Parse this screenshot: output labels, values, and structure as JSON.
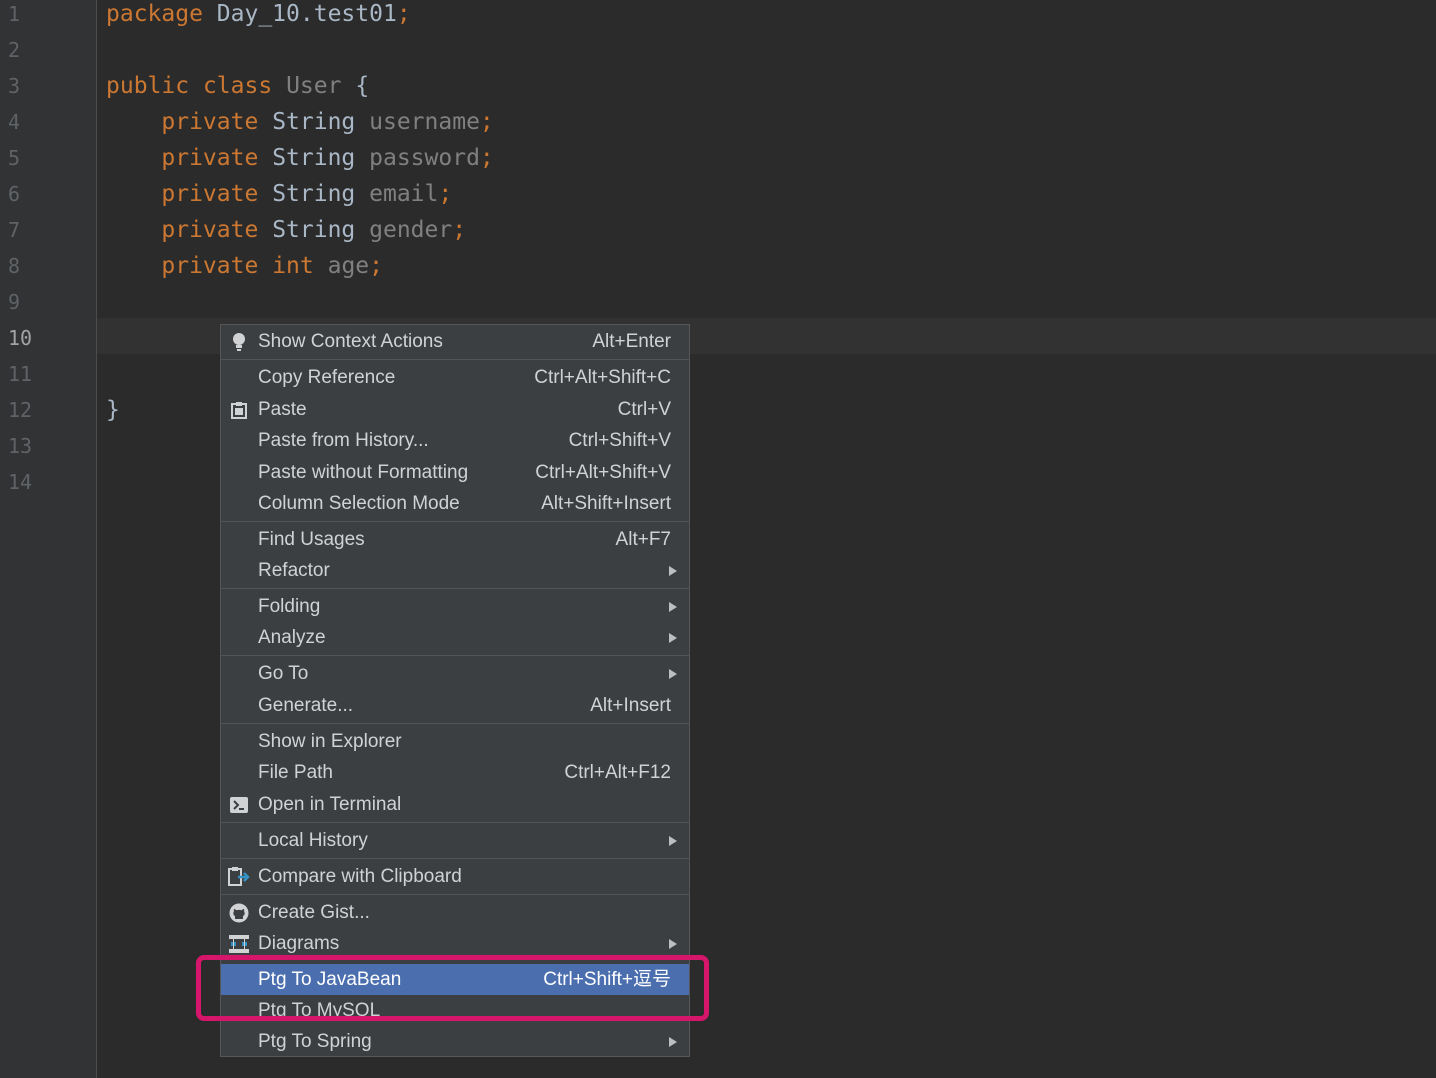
{
  "gutter": {
    "line_numbers": [
      "1",
      "2",
      "3",
      "4",
      "5",
      "6",
      "7",
      "8",
      "9",
      "10",
      "11",
      "12",
      "13",
      "14"
    ]
  },
  "code": {
    "line1": {
      "kw": "package",
      "pkg": "Day_10.test01",
      "semi": ";"
    },
    "line3": {
      "kw1": "public",
      "kw2": "class",
      "name": "User",
      "brace": "{"
    },
    "fields": [
      {
        "mod": "private",
        "type": "String",
        "name": "username",
        "semi": ";"
      },
      {
        "mod": "private",
        "type": "String",
        "name": "password",
        "semi": ";"
      },
      {
        "mod": "private",
        "type": "String",
        "name": "email",
        "semi": ";"
      },
      {
        "mod": "private",
        "type": "String",
        "name": "gender",
        "semi": ";"
      },
      {
        "mod": "private",
        "type": "int",
        "name": "age",
        "semi": ";"
      }
    ],
    "closing_brace": "}"
  },
  "context_menu": {
    "items": [
      {
        "label": "Show Context Actions",
        "shortcut": "Alt+Enter",
        "icon": "lightbulb-icon"
      },
      {
        "label": "Copy Reference",
        "shortcut": "Ctrl+Alt+Shift+C"
      },
      {
        "label": "Paste",
        "shortcut": "Ctrl+V",
        "icon": "clipboard-icon"
      },
      {
        "label": "Paste from History...",
        "shortcut": "Ctrl+Shift+V"
      },
      {
        "label": "Paste without Formatting",
        "shortcut": "Ctrl+Alt+Shift+V"
      },
      {
        "label": "Column Selection Mode",
        "shortcut": "Alt+Shift+Insert"
      },
      {
        "label": "Find Usages",
        "shortcut": "Alt+F7"
      },
      {
        "label": "Refactor",
        "submenu": true
      },
      {
        "label": "Folding",
        "submenu": true
      },
      {
        "label": "Analyze",
        "submenu": true
      },
      {
        "label": "Go To",
        "submenu": true
      },
      {
        "label": "Generate...",
        "shortcut": "Alt+Insert"
      },
      {
        "label": "Show in Explorer"
      },
      {
        "label": "File Path",
        "shortcut": "Ctrl+Alt+F12"
      },
      {
        "label": "Open in Terminal",
        "icon": "terminal-icon"
      },
      {
        "label": "Local History",
        "submenu": true
      },
      {
        "label": "Compare with Clipboard",
        "icon": "compare-icon"
      },
      {
        "label": "Create Gist...",
        "icon": "github-icon"
      },
      {
        "label": "Diagrams",
        "submenu": true,
        "icon": "diagram-icon"
      },
      {
        "label": "Ptg To JavaBean",
        "shortcut": "Ctrl+Shift+逗号",
        "selected": true
      },
      {
        "label": "Ptg To MySQL"
      },
      {
        "label": "Ptg To Spring",
        "submenu": true
      }
    ]
  },
  "colors": {
    "editor_bg": "#2b2b2b",
    "gutter_bg": "#313335",
    "keyword": "#cc7832",
    "field": "#9876aa",
    "menu_bg": "#3c3f41",
    "selection": "#4b6eaf",
    "highlight_border": "#d6166b"
  }
}
